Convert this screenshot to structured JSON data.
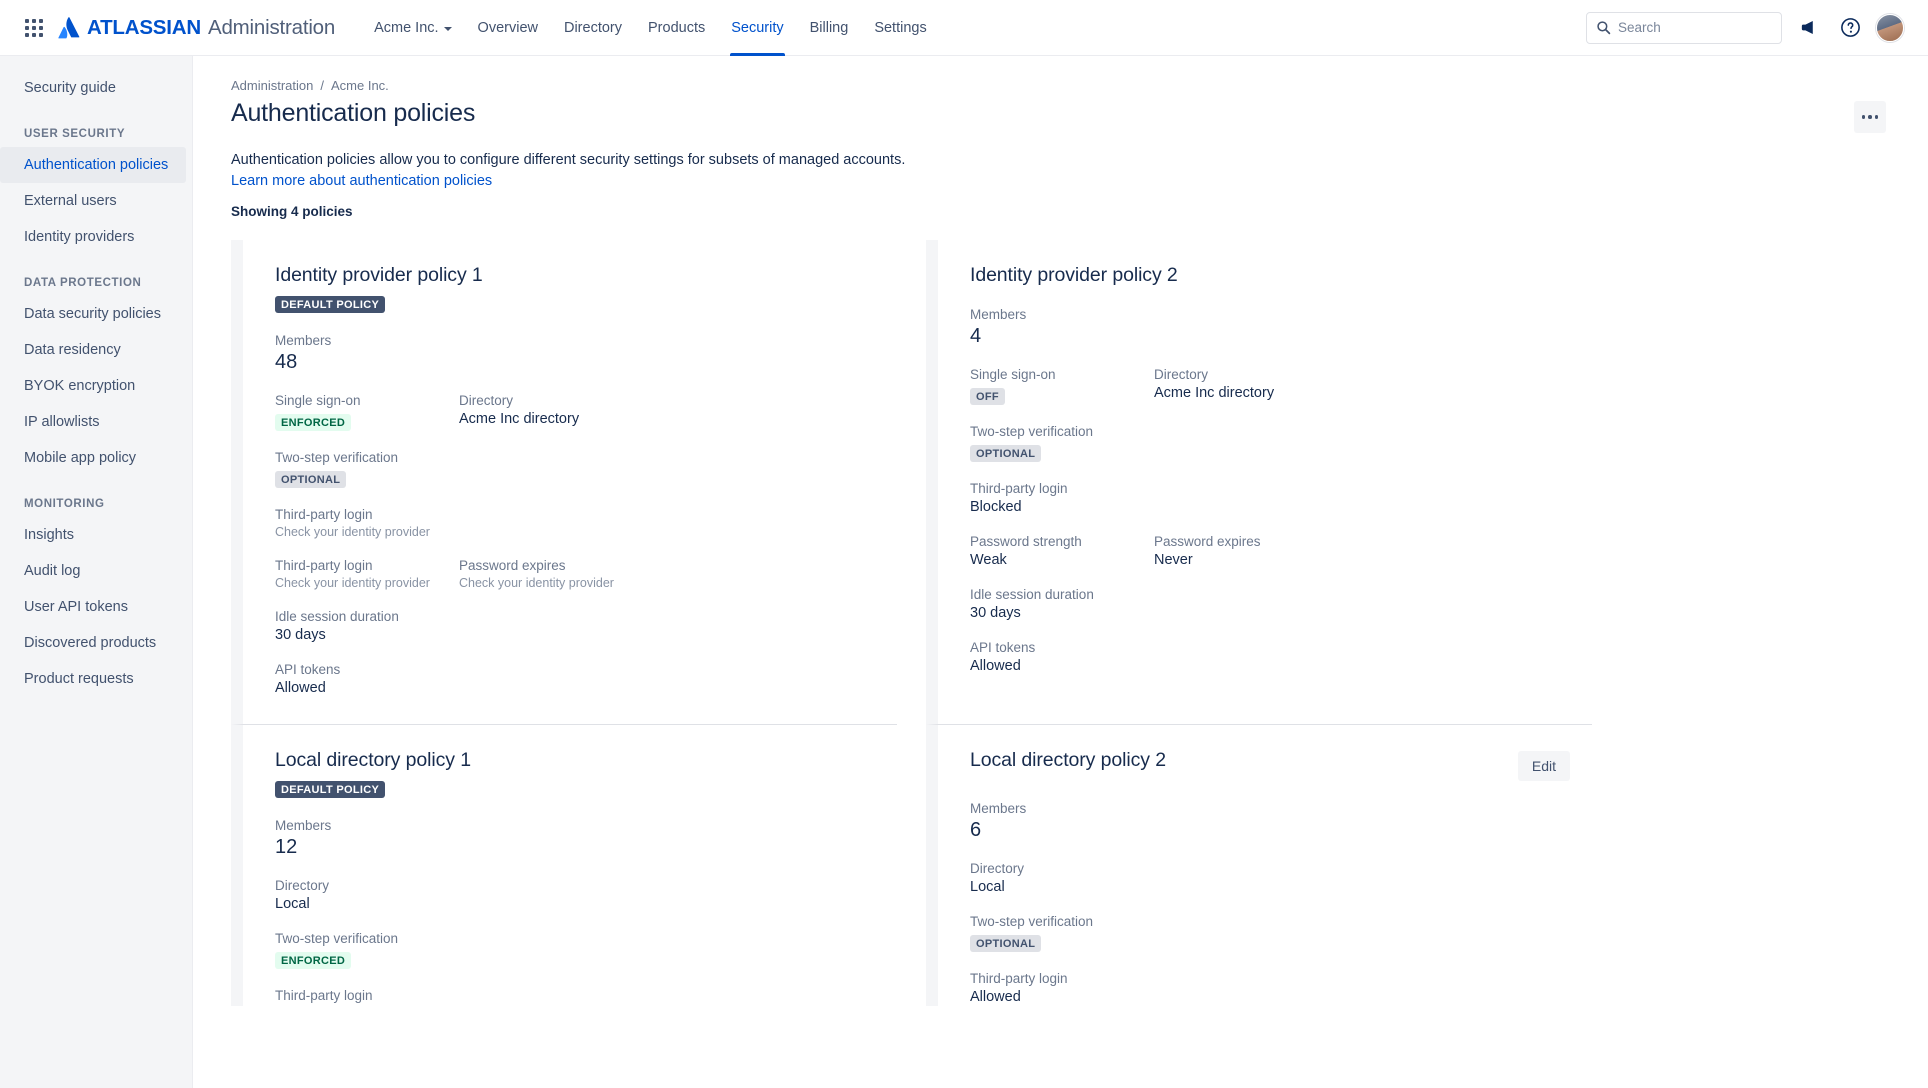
{
  "topnav": {
    "app_switcher_icon": "grid-apps-icon",
    "brand_bold": "ATLASSIAN",
    "brand_light": "Administration",
    "items": [
      {
        "label": "Acme Inc.",
        "has_caret": true,
        "active": false
      },
      {
        "label": "Overview",
        "has_caret": false,
        "active": false
      },
      {
        "label": "Directory",
        "has_caret": false,
        "active": false
      },
      {
        "label": "Products",
        "has_caret": false,
        "active": false
      },
      {
        "label": "Security",
        "has_caret": false,
        "active": true
      },
      {
        "label": "Billing",
        "has_caret": false,
        "active": false
      },
      {
        "label": "Settings",
        "has_caret": false,
        "active": false
      }
    ],
    "search": {
      "placeholder": "Search",
      "value": "",
      "icon": "search-icon"
    },
    "notifications_icon": "megaphone-icon",
    "help_icon": "help-circle-icon",
    "avatar_icon": "user-avatar"
  },
  "sidebar": {
    "top_items": [
      {
        "label": "Security guide",
        "selected": false
      }
    ],
    "groups": [
      {
        "heading": "USER SECURITY",
        "items": [
          {
            "label": "Authentication policies",
            "selected": true
          },
          {
            "label": "External users",
            "selected": false
          },
          {
            "label": "Identity providers",
            "selected": false
          }
        ]
      },
      {
        "heading": "DATA PROTECTION",
        "items": [
          {
            "label": "Data security policies",
            "selected": false
          },
          {
            "label": "Data residency",
            "selected": false
          },
          {
            "label": "BYOK encryption",
            "selected": false
          },
          {
            "label": "IP allowlists",
            "selected": false
          },
          {
            "label": "Mobile app policy",
            "selected": false
          }
        ]
      },
      {
        "heading": "MONITORING",
        "items": [
          {
            "label": "Insights",
            "selected": false
          },
          {
            "label": "Audit log",
            "selected": false
          },
          {
            "label": "User API tokens",
            "selected": false
          },
          {
            "label": "Discovered products",
            "selected": false
          },
          {
            "label": "Product requests",
            "selected": false
          }
        ]
      }
    ]
  },
  "page": {
    "breadcrumb": [
      "Administration",
      "Acme Inc."
    ],
    "breadcrumb_separator": "/",
    "title": "Authentication policies",
    "more_button_icon": "more-horizontal-icon",
    "description_text": "Authentication policies allow you to configure different security settings for subsets of managed accounts. ",
    "description_link": "Learn more about authentication policies",
    "showing": "Showing 4 policies"
  },
  "policies": [
    {
      "name": "Identity provider policy 1",
      "badge": "DEFAULT POLICY",
      "members_label": "Members",
      "members_value": "48",
      "edit_label": "",
      "rows": [
        {
          "left": {
            "label": "Single sign-on",
            "value": "ENFORCED",
            "kind": "lozenge-enforced"
          },
          "right": {
            "label": "Directory",
            "value": "Acme Inc directory",
            "kind": "text"
          }
        },
        {
          "left": {
            "label": "Two-step verification",
            "value": "OPTIONAL",
            "kind": "lozenge-neutral"
          },
          "right": null
        },
        {
          "left": {
            "label": "Third-party login",
            "value": "Check your identity provider",
            "kind": "muted"
          },
          "right": null
        },
        {
          "left": {
            "label": "Third-party login",
            "value": "Check your identity provider",
            "kind": "muted"
          },
          "right": {
            "label": "Password expires",
            "value": "Check your identity provider",
            "kind": "muted"
          }
        },
        {
          "left": {
            "label": "Idle session duration",
            "value": "30 days",
            "kind": "text"
          },
          "right": null
        },
        {
          "left": {
            "label": "API tokens",
            "value": "Allowed",
            "kind": "text"
          },
          "right": null
        }
      ]
    },
    {
      "name": "Identity provider policy 2",
      "badge": "",
      "members_label": "Members",
      "members_value": "4",
      "edit_label": "",
      "rows": [
        {
          "left": {
            "label": "Single sign-on",
            "value": "OFF",
            "kind": "lozenge-neutral"
          },
          "right": {
            "label": "Directory",
            "value": "Acme Inc directory",
            "kind": "text"
          }
        },
        {
          "left": {
            "label": "Two-step verification",
            "value": "OPTIONAL",
            "kind": "lozenge-neutral"
          },
          "right": null
        },
        {
          "left": {
            "label": "Third-party login",
            "value": "Blocked",
            "kind": "text"
          },
          "right": null
        },
        {
          "left": {
            "label": "Password strength",
            "value": "Weak",
            "kind": "text"
          },
          "right": {
            "label": "Password expires",
            "value": "Never",
            "kind": "text"
          }
        },
        {
          "left": {
            "label": "Idle session duration",
            "value": "30 days",
            "kind": "text"
          },
          "right": null
        },
        {
          "left": {
            "label": "API tokens",
            "value": "Allowed",
            "kind": "text"
          },
          "right": null
        }
      ]
    },
    {
      "name": "Local directory policy 1",
      "badge": "DEFAULT POLICY",
      "members_label": "Members",
      "members_value": "12",
      "edit_label": "",
      "rows": [
        {
          "left": {
            "label": "Directory",
            "value": "Local",
            "kind": "text"
          },
          "right": null
        },
        {
          "left": {
            "label": "Two-step verification",
            "value": "ENFORCED",
            "kind": "lozenge-enforced"
          },
          "right": null
        },
        {
          "left": {
            "label": "Third-party login",
            "value": "",
            "kind": "text"
          },
          "right": null
        }
      ]
    },
    {
      "name": "Local directory policy 2",
      "badge": "",
      "members_label": "Members",
      "members_value": "6",
      "edit_label": "Edit",
      "rows": [
        {
          "left": {
            "label": "Directory",
            "value": "Local",
            "kind": "text"
          },
          "right": null
        },
        {
          "left": {
            "label": "Two-step verification",
            "value": "OPTIONAL",
            "kind": "lozenge-neutral"
          },
          "right": null
        },
        {
          "left": {
            "label": "Third-party login",
            "value": "Allowed",
            "kind": "text"
          },
          "right": null
        }
      ]
    }
  ],
  "colors": {
    "brand_blue": "#0052CC",
    "text_primary": "#172B4D",
    "text_subtle": "#6B778C",
    "sidebar_bg": "#F4F5F7",
    "lozenge_success_bg": "#E3FCEF",
    "lozenge_success_fg": "#006644",
    "lozenge_neutral_bg": "#DFE1E6",
    "lozenge_default_bg": "#42526E"
  }
}
